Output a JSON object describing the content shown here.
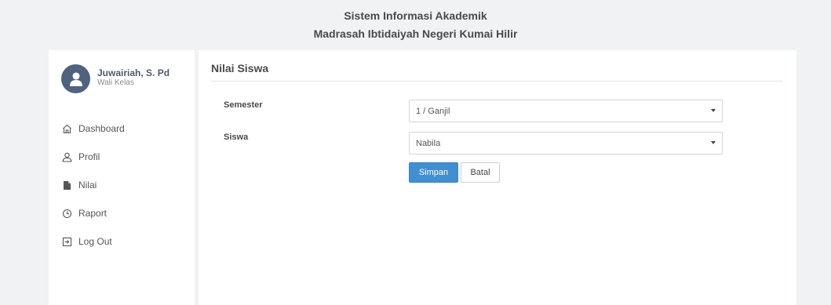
{
  "header": {
    "line1": "Sistem Informasi Akademik",
    "line2": "Madrasah Ibtidaiyah Negeri Kumai Hilir"
  },
  "user": {
    "name": "Juwairiah, S. Pd",
    "role": "Wali Kelas"
  },
  "nav": {
    "dashboard": "Dashboard",
    "profil": "Profil",
    "nilai": "Nilai",
    "raport": "Raport",
    "logout": "Log Out"
  },
  "page": {
    "title": "Nilai Siswa",
    "semester_label": "Semester",
    "semester_value": "1 / Ganjil",
    "siswa_label": "Siswa",
    "siswa_value": "Nabila",
    "save_label": "Simpan",
    "cancel_label": "Batal"
  },
  "colors": {
    "primary": "#3f8fd2",
    "avatar": "#4f6280",
    "background": "#f1f2f3"
  }
}
